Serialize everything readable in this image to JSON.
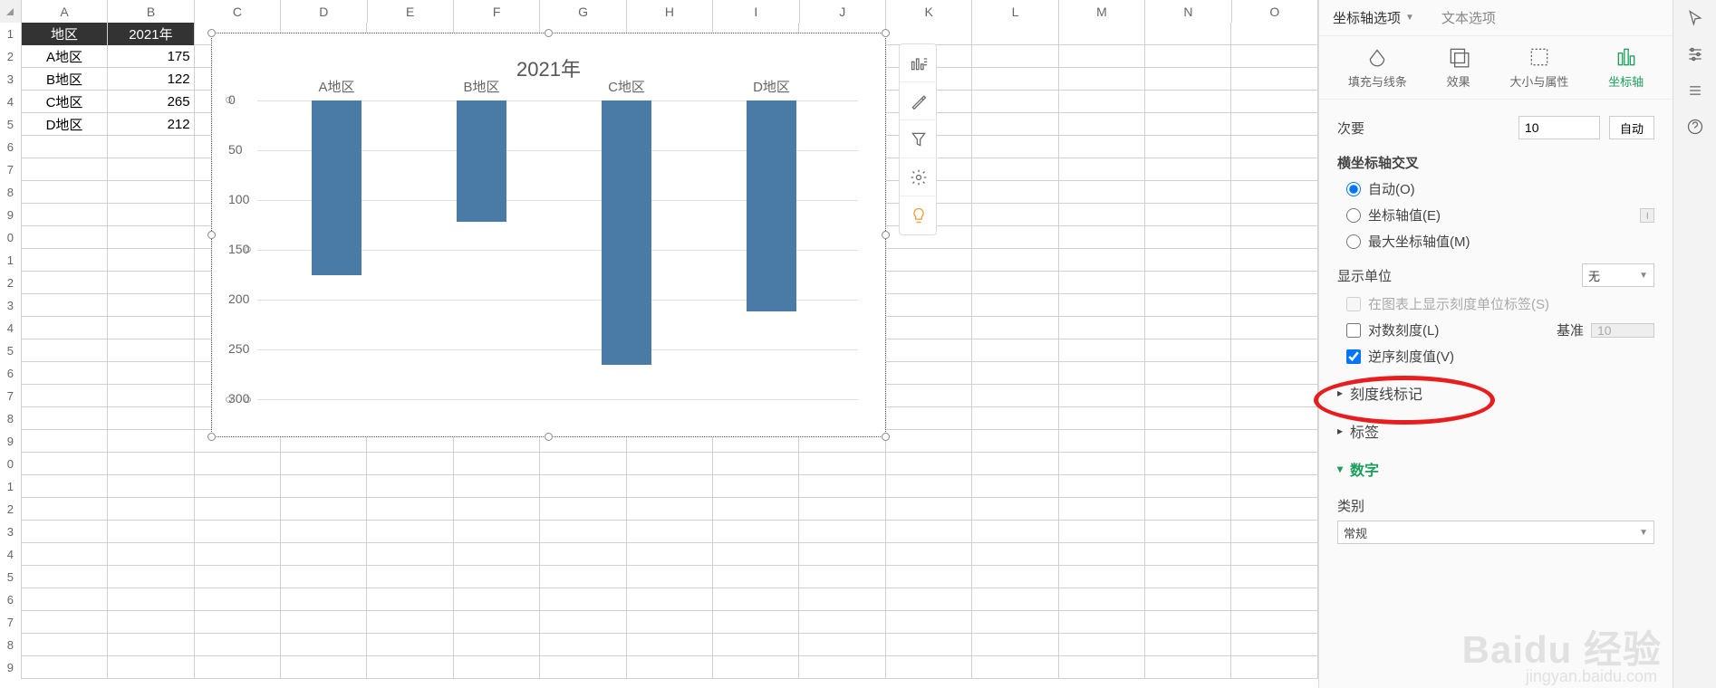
{
  "columns": [
    "A",
    "B",
    "C",
    "D",
    "E",
    "F",
    "G",
    "H",
    "I",
    "J",
    "K",
    "L",
    "M",
    "N",
    "O"
  ],
  "rows_visible": [
    "1",
    "2",
    "3",
    "4",
    "5",
    "6",
    "7",
    "8",
    "9",
    "0",
    "1",
    "2",
    "3",
    "4",
    "5",
    "6",
    "7",
    "8",
    "9",
    "0",
    "1",
    "2",
    "3",
    "4",
    "5",
    "6",
    "7",
    "8",
    "9"
  ],
  "table": {
    "header": [
      "地区",
      "2021年"
    ],
    "rows": [
      [
        "A地区",
        "175"
      ],
      [
        "B地区",
        "122"
      ],
      [
        "C地区",
        "265"
      ],
      [
        "D地区",
        "212"
      ]
    ]
  },
  "chart_data": {
    "type": "bar",
    "title": "2021年",
    "categories": [
      "A地区",
      "B地区",
      "C地区",
      "D地区"
    ],
    "values": [
      175,
      122,
      265,
      212
    ],
    "xlabel": "",
    "ylabel": "",
    "ylim": [
      0,
      300
    ],
    "y_ticks": [
      0,
      50,
      100,
      150,
      200,
      250,
      300
    ],
    "y_reversed": true
  },
  "chart_tools": [
    "chart-element-icon",
    "brush-icon",
    "filter-icon",
    "gear-icon",
    "lightbulb-icon"
  ],
  "panel": {
    "tab_axis_options": "坐标轴选项",
    "tab_text_options": "文本选项",
    "icon_fill_line": "填充与线条",
    "icon_effects": "效果",
    "icon_size_props": "大小与属性",
    "icon_axis": "坐标轴",
    "minor_label": "次要",
    "minor_value": "10",
    "auto_btn": "自动",
    "cross_section": "横坐标轴交叉",
    "cross_auto": "自动(O)",
    "cross_axis_value": "坐标轴值(E)",
    "cross_axis_value_input": "0",
    "cross_max": "最大坐标轴值(M)",
    "display_unit_label": "显示单位",
    "display_unit_value": "无",
    "show_unit_label_check": "在图表上显示刻度单位标签(S)",
    "log_scale_check": "对数刻度(L)",
    "log_base_label": "基准",
    "log_base_value": "10",
    "reverse_check": "逆序刻度值(V)",
    "tick_marks": "刻度线标记",
    "labels": "标签",
    "number": "数字",
    "category_label": "类别",
    "category_value": "常规"
  },
  "watermark": "Baidu 经验",
  "watermark_sub": "jingyan.baidu.com"
}
